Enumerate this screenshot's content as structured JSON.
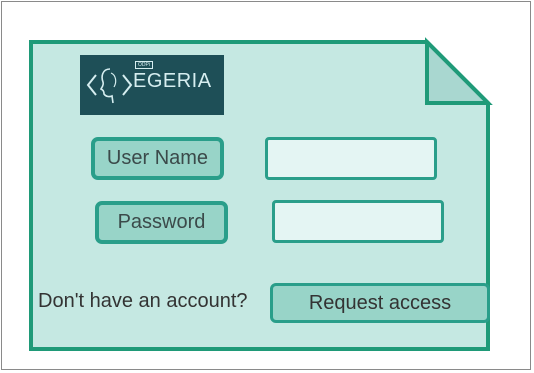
{
  "logo": {
    "brand_text": "EGERIA",
    "badge_text": "ODPi"
  },
  "form": {
    "username_label": "User Name",
    "username_value": "",
    "password_label": "Password",
    "password_value": "",
    "no_account_text": "Don't have an account?",
    "request_access_label": "Request access"
  },
  "colors": {
    "card_fill": "#c5e8e2",
    "card_border": "#1f9a78",
    "label_fill": "#98d4c8",
    "logo_background": "#1e4f57"
  }
}
